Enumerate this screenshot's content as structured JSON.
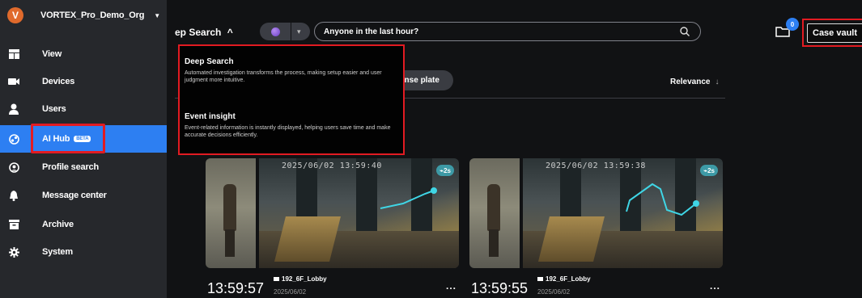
{
  "org": {
    "avatar_letter": "V",
    "name": "VORTEX_Pro_Demo_Org",
    "caret": "▼"
  },
  "sidebar": {
    "items": [
      {
        "label": "View",
        "icon": "view-grid-icon"
      },
      {
        "label": "Devices",
        "icon": "camera-icon"
      },
      {
        "label": "Users",
        "icon": "user-icon"
      },
      {
        "label": "AI Hub",
        "icon": "ai-hub-icon",
        "badge": "BETA",
        "active": true
      },
      {
        "label": "Profile search",
        "icon": "profile-search-icon"
      },
      {
        "label": "Message center",
        "icon": "bell-icon"
      },
      {
        "label": "Archive",
        "icon": "archive-icon"
      },
      {
        "label": "System",
        "icon": "gear-icon"
      }
    ]
  },
  "topbar": {
    "mode_label": "ep Search",
    "mode_caret": "^",
    "search_value": "Anyone in the last hour?",
    "notification_count": "0",
    "case_vault_label": "Case vault"
  },
  "filters": {
    "chip_label": "ense plate",
    "sort_label": "Relevance",
    "sort_arrow": "↓"
  },
  "dropdown": {
    "items": [
      {
        "title": "Deep Search",
        "description": "Automated investigation transforms the process, making setup easier and user judgment more intuitive."
      },
      {
        "title": "Event insight",
        "description": "Event-related information is instantly displayed, helping users save time and make accurate decisions efficiently."
      }
    ]
  },
  "results": [
    {
      "time": "13:59:57",
      "camera": "192_6F_Lobby",
      "date": "2025/06/02",
      "overlay_timestamp": "2025/06/02 13:59:40",
      "duration": "2s",
      "more": "..."
    },
    {
      "time": "13:59:55",
      "camera": "192_6F_Lobby",
      "date": "2025/06/02",
      "overlay_timestamp": "2025/06/02 13:59:38",
      "duration": "2s",
      "more": "..."
    }
  ],
  "colors": {
    "accent": "#2d7ff2",
    "highlight_box": "#e21b22",
    "sidebar_bg": "#26282c",
    "page_bg": "#111214"
  }
}
